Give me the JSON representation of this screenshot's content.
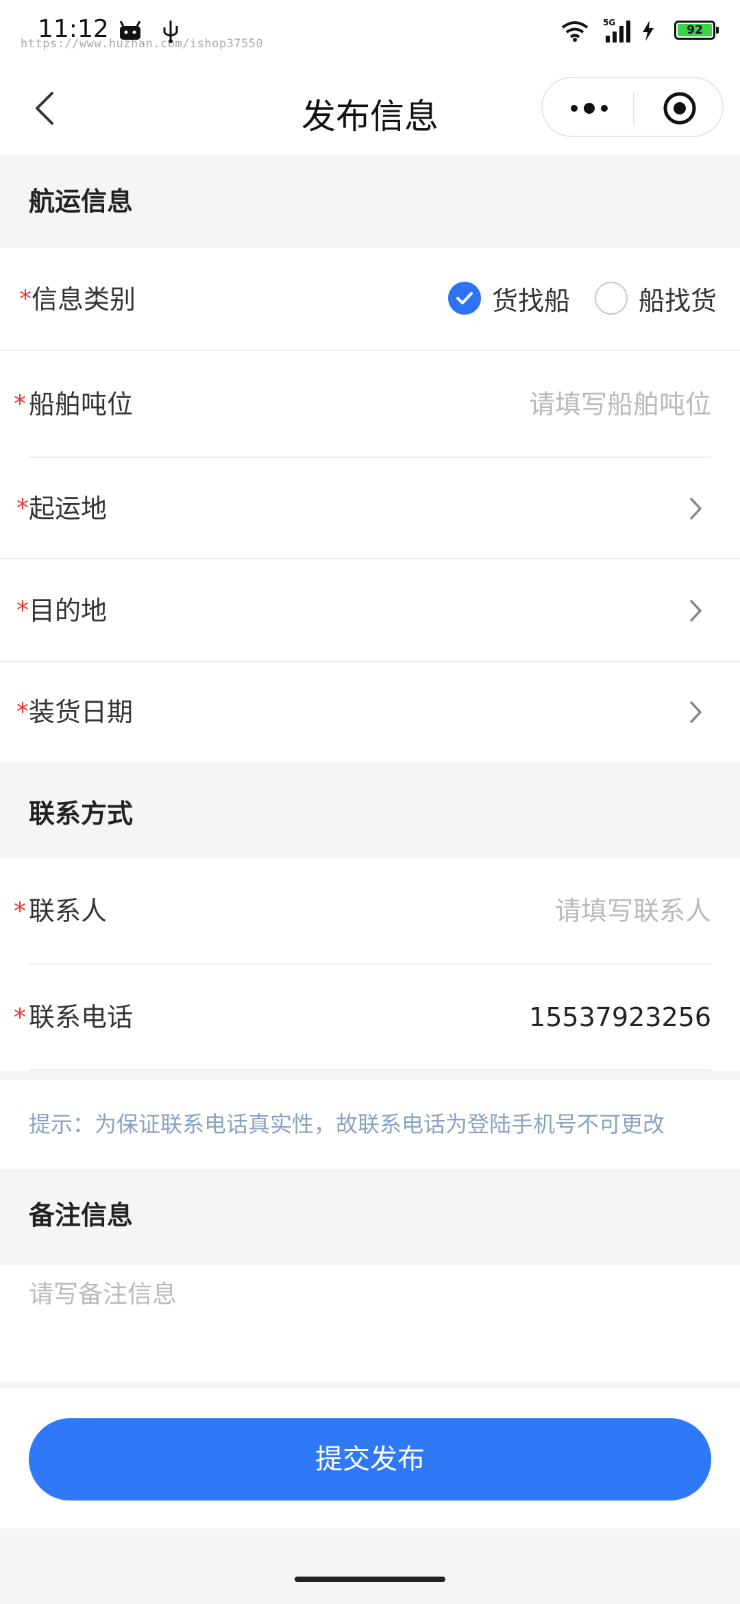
{
  "status_bar": {
    "time": "11:12",
    "watermark": "https://www.huzhan.com/ishop37550",
    "network_label": "5G",
    "battery": "92"
  },
  "nav": {
    "title": "发布信息",
    "back_icon": "chevron-left-icon",
    "more_icon": "more-dots-icon",
    "close_icon": "target-circle-icon"
  },
  "shipping_section": {
    "title": "航运信息",
    "required_mark": "*",
    "info_type": {
      "label": "信息类别",
      "options": [
        {
          "label": "货找船",
          "checked": true
        },
        {
          "label": "船找货",
          "checked": false
        }
      ]
    },
    "tonnage": {
      "label": "船舶吨位",
      "value": "",
      "placeholder": "请填写船舶吨位"
    },
    "origin": {
      "label": "起运地"
    },
    "destination": {
      "label": "目的地"
    },
    "loading_date": {
      "label": "装货日期"
    }
  },
  "contact_section": {
    "title": "联系方式",
    "contact_person": {
      "label": "联系人",
      "value": "",
      "placeholder": "请填写联系人"
    },
    "contact_phone": {
      "label": "联系电话",
      "value": "15537923256"
    },
    "hint": "提示：为保证联系电话真实性，故联系电话为登陆手机号不可更改"
  },
  "notes_section": {
    "title": "备注信息",
    "placeholder": "请写备注信息",
    "value": ""
  },
  "submit_label": "提交发布",
  "colors": {
    "accent": "#2f79f6",
    "required": "#e53935",
    "hint": "#8aa2c4",
    "placeholder": "#b9b9c0"
  }
}
